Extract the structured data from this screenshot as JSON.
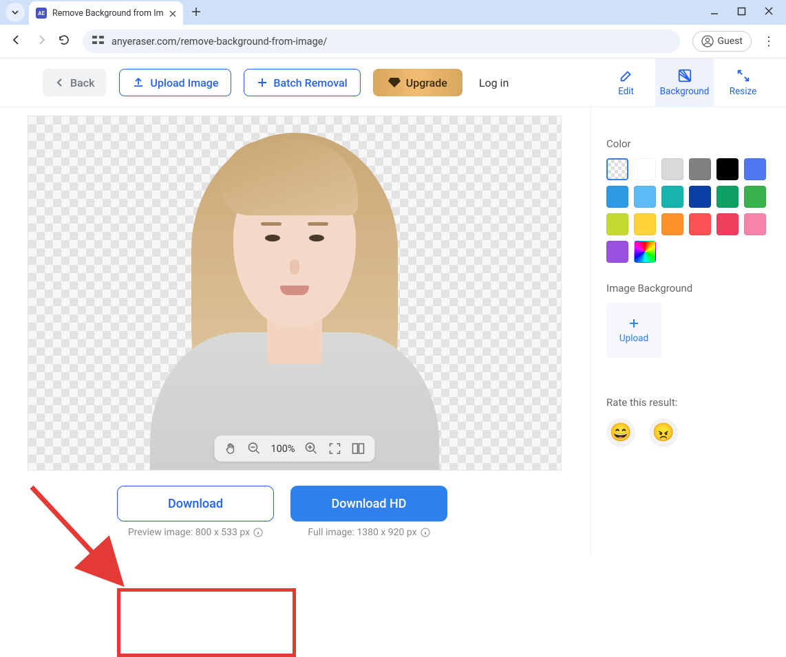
{
  "browser": {
    "tab_title": "Remove Background from Im",
    "url": "anyeraser.com/remove-background-from-image/",
    "guest_label": "Guest"
  },
  "toolbar": {
    "back": "Back",
    "upload": "Upload Image",
    "batch": "Batch Removal",
    "upgrade": "Upgrade",
    "login": "Log in",
    "tabs": {
      "edit": "Edit",
      "background": "Background",
      "resize": "Resize"
    }
  },
  "zoom": {
    "percent": "100%"
  },
  "download": {
    "preview_btn": "Download",
    "hd_btn": "Download HD",
    "preview_meta": "Preview image: 800 x 533 px",
    "full_meta": "Full image: 1380 x 920 px"
  },
  "panel": {
    "color_label": "Color",
    "colors": [
      "transparent",
      "#ffffff",
      "#d9d9d9",
      "#808080",
      "#000000",
      "#5078f0",
      "#2f99e6",
      "#5cbbf2",
      "#17b3ad",
      "#0a3fa3",
      "#0ea163",
      "#37b24d",
      "#c5d934",
      "#ffd43b",
      "#ff922b",
      "#fa5252",
      "#f03e5e",
      "#f783ac",
      "#9b51e0",
      "rainbow"
    ],
    "img_bg_label": "Image Background",
    "upload_label": "Upload",
    "rate_label": "Rate this result:"
  }
}
